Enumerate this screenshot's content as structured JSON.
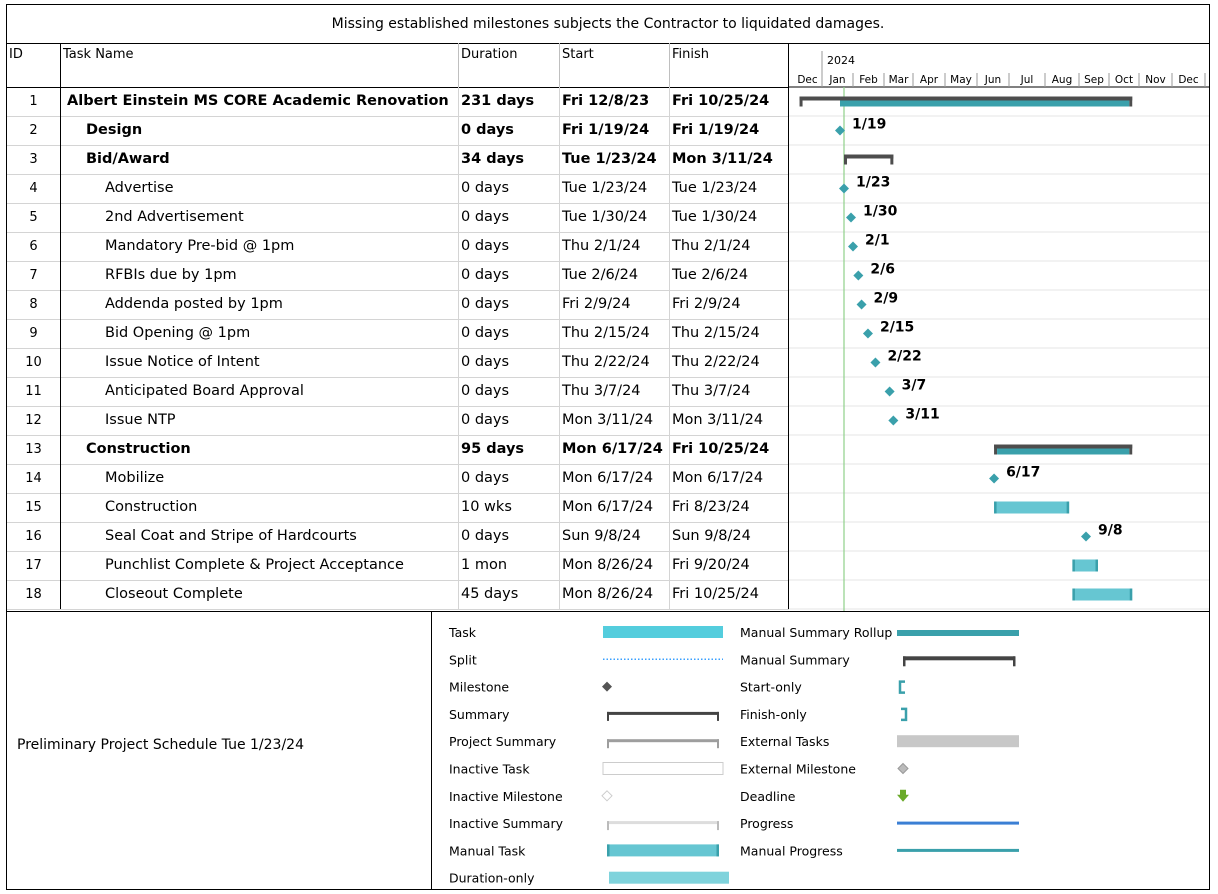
{
  "note": "Missing established milestones subjects the Contractor to liquidated damages.",
  "columns": {
    "id": "ID",
    "name": "Task Name",
    "duration": "Duration",
    "start": "Start",
    "finish": "Finish"
  },
  "timescale": {
    "year": "2024",
    "months": [
      "Dec",
      "Jan",
      "Feb",
      "Mar",
      "Apr",
      "May",
      "Jun",
      "Jul",
      "Aug",
      "Sep",
      "Oct",
      "Nov",
      "Dec"
    ]
  },
  "tasks": [
    {
      "id": "1",
      "name": "Albert Einstein MS CORE Academic Renovation",
      "duration": "231 days",
      "start": "Fri 12/8/23",
      "finish": "Fri 10/25/24",
      "level": 0,
      "bold": true,
      "kind": "project"
    },
    {
      "id": "2",
      "name": "Design",
      "duration": "0 days",
      "start": "Fri 1/19/24",
      "finish": "Fri 1/19/24",
      "level": 1,
      "bold": true,
      "kind": "milestone",
      "label": "1/19"
    },
    {
      "id": "3",
      "name": "Bid/Award",
      "duration": "34 days",
      "start": "Tue 1/23/24",
      "finish": "Mon 3/11/24",
      "level": 1,
      "bold": true,
      "kind": "summary"
    },
    {
      "id": "4",
      "name": "Advertise",
      "duration": "0 days",
      "start": "Tue 1/23/24",
      "finish": "Tue 1/23/24",
      "level": 2,
      "bold": false,
      "kind": "milestone",
      "label": "1/23"
    },
    {
      "id": "5",
      "name": "2nd Advertisement",
      "duration": "0 days",
      "start": "Tue 1/30/24",
      "finish": "Tue 1/30/24",
      "level": 2,
      "bold": false,
      "kind": "milestone",
      "label": "1/30"
    },
    {
      "id": "6",
      "name": "Mandatory Pre-bid @ 1pm",
      "duration": "0 days",
      "start": "Thu 2/1/24",
      "finish": "Thu 2/1/24",
      "level": 2,
      "bold": false,
      "kind": "milestone",
      "label": "2/1"
    },
    {
      "id": "7",
      "name": "RFBIs due by 1pm",
      "duration": "0 days",
      "start": "Tue 2/6/24",
      "finish": "Tue 2/6/24",
      "level": 2,
      "bold": false,
      "kind": "milestone",
      "label": "2/6"
    },
    {
      "id": "8",
      "name": "Addenda posted by 1pm",
      "duration": "0 days",
      "start": "Fri 2/9/24",
      "finish": "Fri 2/9/24",
      "level": 2,
      "bold": false,
      "kind": "milestone",
      "label": "2/9"
    },
    {
      "id": "9",
      "name": "Bid Opening @ 1pm",
      "duration": "0 days",
      "start": "Thu 2/15/24",
      "finish": "Thu 2/15/24",
      "level": 2,
      "bold": false,
      "kind": "milestone",
      "label": "2/15"
    },
    {
      "id": "10",
      "name": "Issue Notice of Intent",
      "duration": "0 days",
      "start": "Thu 2/22/24",
      "finish": "Thu 2/22/24",
      "level": 2,
      "bold": false,
      "kind": "milestone",
      "label": "2/22"
    },
    {
      "id": "11",
      "name": "Anticipated Board Approval",
      "duration": "0 days",
      "start": "Thu 3/7/24",
      "finish": "Thu 3/7/24",
      "level": 2,
      "bold": false,
      "kind": "milestone",
      "label": "3/7"
    },
    {
      "id": "12",
      "name": "Issue NTP",
      "duration": "0 days",
      "start": "Mon 3/11/24",
      "finish": "Mon 3/11/24",
      "level": 2,
      "bold": false,
      "kind": "milestone",
      "label": "3/11"
    },
    {
      "id": "13",
      "name": "Construction",
      "duration": "95 days",
      "start": "Mon 6/17/24",
      "finish": "Fri 10/25/24",
      "level": 1,
      "bold": true,
      "kind": "summary-rollup"
    },
    {
      "id": "14",
      "name": "Mobilize",
      "duration": "0 days",
      "start": "Mon 6/17/24",
      "finish": "Mon 6/17/24",
      "level": 2,
      "bold": false,
      "kind": "milestone",
      "label": "6/17"
    },
    {
      "id": "15",
      "name": "Construction",
      "duration": "10 wks",
      "start": "Mon 6/17/24",
      "finish": "Fri 8/23/24",
      "level": 2,
      "bold": false,
      "kind": "manual-task"
    },
    {
      "id": "16",
      "name": "Seal Coat and Stripe of Hardcourts",
      "duration": "0 days",
      "start": "Sun 9/8/24",
      "finish": "Sun 9/8/24",
      "level": 2,
      "bold": false,
      "kind": "milestone",
      "label": "9/8"
    },
    {
      "id": "17",
      "name": "Punchlist Complete & Project Acceptance",
      "duration": "1 mon",
      "start": "Mon 8/26/24",
      "finish": "Fri 9/20/24",
      "level": 2,
      "bold": false,
      "kind": "manual-task"
    },
    {
      "id": "18",
      "name": "Closeout Complete",
      "duration": "45 days",
      "start": "Mon 8/26/24",
      "finish": "Fri 10/25/24",
      "level": 2,
      "bold": false,
      "kind": "manual-task"
    }
  ],
  "status_date": "1/23/24",
  "legend": {
    "title": "Preliminary Project Schedule Tue 1/23/24",
    "left": [
      "Task",
      "Split",
      "Milestone",
      "Summary",
      "Project Summary",
      "Inactive Task",
      "Inactive Milestone",
      "Inactive Summary",
      "Manual Task",
      "Duration-only"
    ],
    "right": [
      "Manual Summary Rollup",
      "Manual Summary",
      "Start-only",
      "Finish-only",
      "External Tasks",
      "External Milestone",
      "Deadline",
      "Progress",
      "Manual Progress"
    ]
  },
  "colors": {
    "teal": "#3aa0ab",
    "task": "#54cddd",
    "manual": "#66c6d2",
    "summary": "#4d4d4d",
    "progress": "#3b7fd4"
  }
}
